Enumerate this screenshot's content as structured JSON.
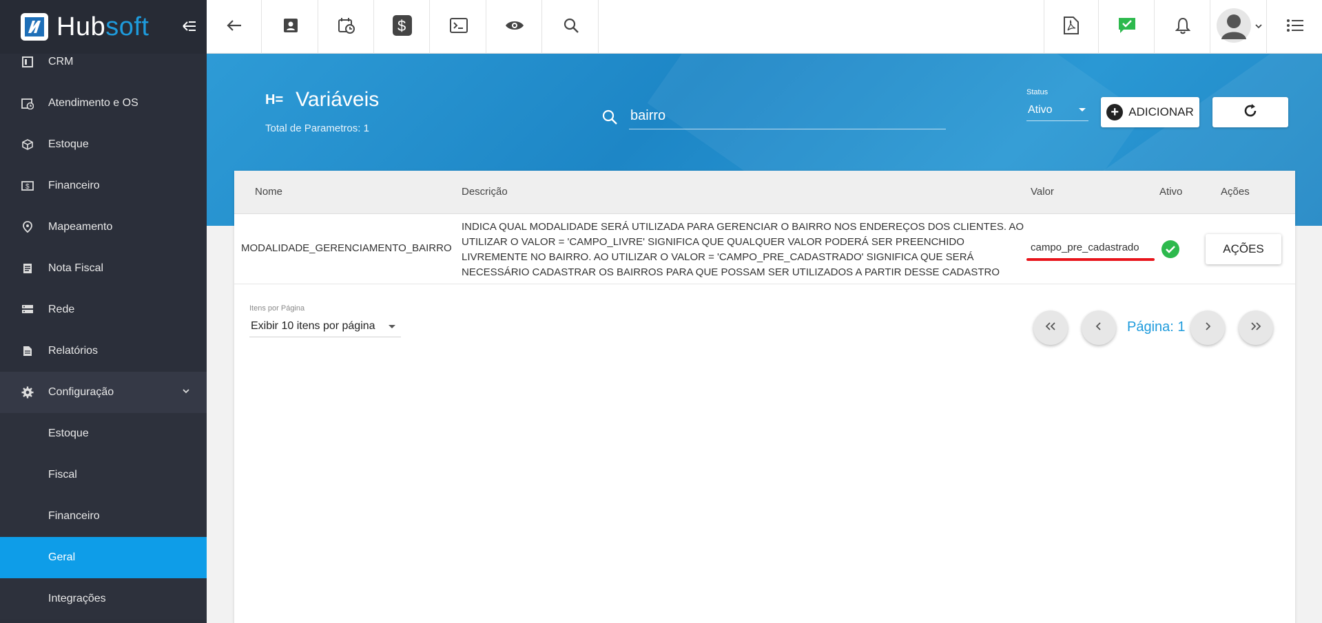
{
  "brand": {
    "name_white": "Hub",
    "name_blue": "soft"
  },
  "sidebar": {
    "items": [
      {
        "label": "CRM",
        "icon": "crm-icon"
      },
      {
        "label": "Atendimento e OS",
        "icon": "calendar-clock-icon"
      },
      {
        "label": "Estoque",
        "icon": "box-icon"
      },
      {
        "label": "Financeiro",
        "icon": "money-icon"
      },
      {
        "label": "Mapeamento",
        "icon": "map-pin-icon"
      },
      {
        "label": "Nota Fiscal",
        "icon": "receipt-icon"
      },
      {
        "label": "Rede",
        "icon": "server-icon"
      },
      {
        "label": "Relatórios",
        "icon": "report-icon"
      },
      {
        "label": "Configuração",
        "icon": "gear-icon"
      }
    ],
    "subitems": [
      {
        "label": "Estoque"
      },
      {
        "label": "Fiscal"
      },
      {
        "label": "Financeiro"
      },
      {
        "label": "Geral"
      },
      {
        "label": "Integrações"
      }
    ]
  },
  "topbar": {
    "icons": [
      "back-arrow-icon",
      "contact-icon",
      "calendar-clock-icon",
      "dollar-icon",
      "terminal-icon",
      "eye-icon",
      "search-icon",
      "pdf-icon",
      "chat-check-icon",
      "bell-icon",
      "avatar",
      "menu-list-icon"
    ]
  },
  "page": {
    "title": "Variáveis",
    "total": "Total de Parametros: 1"
  },
  "search": {
    "value": "bairro",
    "placeholder": ""
  },
  "status": {
    "label": "Status",
    "value": "Ativo"
  },
  "actions": {
    "add_label": "ADICIONAR"
  },
  "table": {
    "headers": {
      "nome": "Nome",
      "descricao": "Descrição",
      "valor": "Valor",
      "ativo": "Ativo",
      "acoes": "Ações"
    },
    "rows": [
      {
        "nome": "MODALIDADE_GERENCIAMENTO_BAIRRO",
        "descricao": "INDICA QUAL MODALIDADE SERÁ UTILIZADA PARA GERENCIAR O BAIRRO NOS ENDEREÇOS DOS CLIENTES. AO UTILIZAR O VALOR = 'CAMPO_LIVRE' SIGNIFICA QUE QUALQUER VALOR PODERÁ SER PREENCHIDO LIVREMENTE NO BAIRRO. AO UTILIZAR O VALOR = 'CAMPO_PRE_CADASTRADO' SIGNIFICA QUE SERÁ NECESSÁRIO CADASTRAR OS BAIRROS PARA QUE POSSAM SER UTILIZADOS A PARTIR DESSE CADASTRO",
        "valor": "campo_pre_cadastrado",
        "ativo": true,
        "acoes_label": "AÇÕES"
      }
    ]
  },
  "pagination": {
    "perpage_label": "Itens por Página",
    "perpage_value": "Exibir 10 itens por página",
    "page_label": "Página: 1"
  },
  "colors": {
    "accent": "#1e9bdc",
    "sidebar": "#2b2f3a",
    "active": "#0e9de8",
    "success": "#2db94d",
    "highlight": "#e8141b"
  }
}
